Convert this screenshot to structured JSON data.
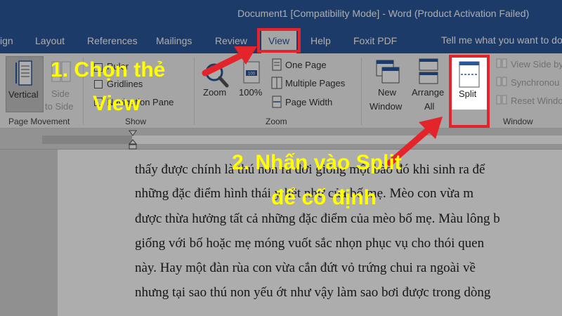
{
  "title_bar": {
    "title": "Document1 [Compatibility Mode]  -  Word (Product Activation Failed)"
  },
  "tabs": [
    {
      "label": "ign"
    },
    {
      "label": "Layout"
    },
    {
      "label": "References"
    },
    {
      "label": "Mailings"
    },
    {
      "label": "Review"
    },
    {
      "label": "View",
      "active": true
    },
    {
      "label": "Help"
    },
    {
      "label": "Foxit PDF"
    }
  ],
  "tell_me": {
    "text": "Tell me what you want to do"
  },
  "ribbon": {
    "page_movement": {
      "group_label": "Page Movement",
      "vertical_label": "Vertical",
      "side_to_side_line1": "Side",
      "side_to_side_line2": "to Side"
    },
    "show": {
      "group_label": "Show",
      "ruler": "Ruler",
      "gridlines": "Gridlines",
      "navigation_pane": "Navigation Pane"
    },
    "zoom": {
      "group_label": "Zoom",
      "zoom_label": "Zoom",
      "hundred_label": "100%",
      "one_page": "One Page",
      "multiple_pages": "Multiple Pages",
      "page_width": "Page Width"
    },
    "window": {
      "group_label": "Window",
      "new_window_line1": "New",
      "new_window_line2": "Window",
      "arrange_all_line1": "Arrange",
      "arrange_all_line2": "All",
      "split": "Split",
      "view_side_by_side": "View Side by",
      "synchronous": "Synchronou",
      "reset_window": "Reset Windo"
    }
  },
  "document_lines": [
    "thấy được chính là thú non ra đời giống một bào đó khi sinh ra để",
    "những đặc điểm hình thái y hệt như của bố mẹ. Mèo con vừa m",
    "được thừa hưởng tất cả những đặc điểm của mèo bố mẹ. Màu lông b",
    "giống với bố hoặc mẹ móng vuốt sắc nhọn phục vụ cho thói quen",
    "này. Hay một đàn rùa con vừa cắn đứt vỏ trứng chui ra ngoài về",
    "nhưng tại sao thú non yếu ớt như vậy làm sao bơi được trong dòng"
  ],
  "annotations": {
    "step1_line1": "1. Chọn thẻ",
    "step1_line2": "View",
    "step2_line1": "2. Nhấn vào Split",
    "step2_line2": "để cố định"
  },
  "colors": {
    "title_bar": "#2b579a",
    "ribbon": "#f3f3f3",
    "highlight_box": "#e3242b",
    "annotation_text": "#ffff00",
    "arrow": "#e3242b"
  }
}
